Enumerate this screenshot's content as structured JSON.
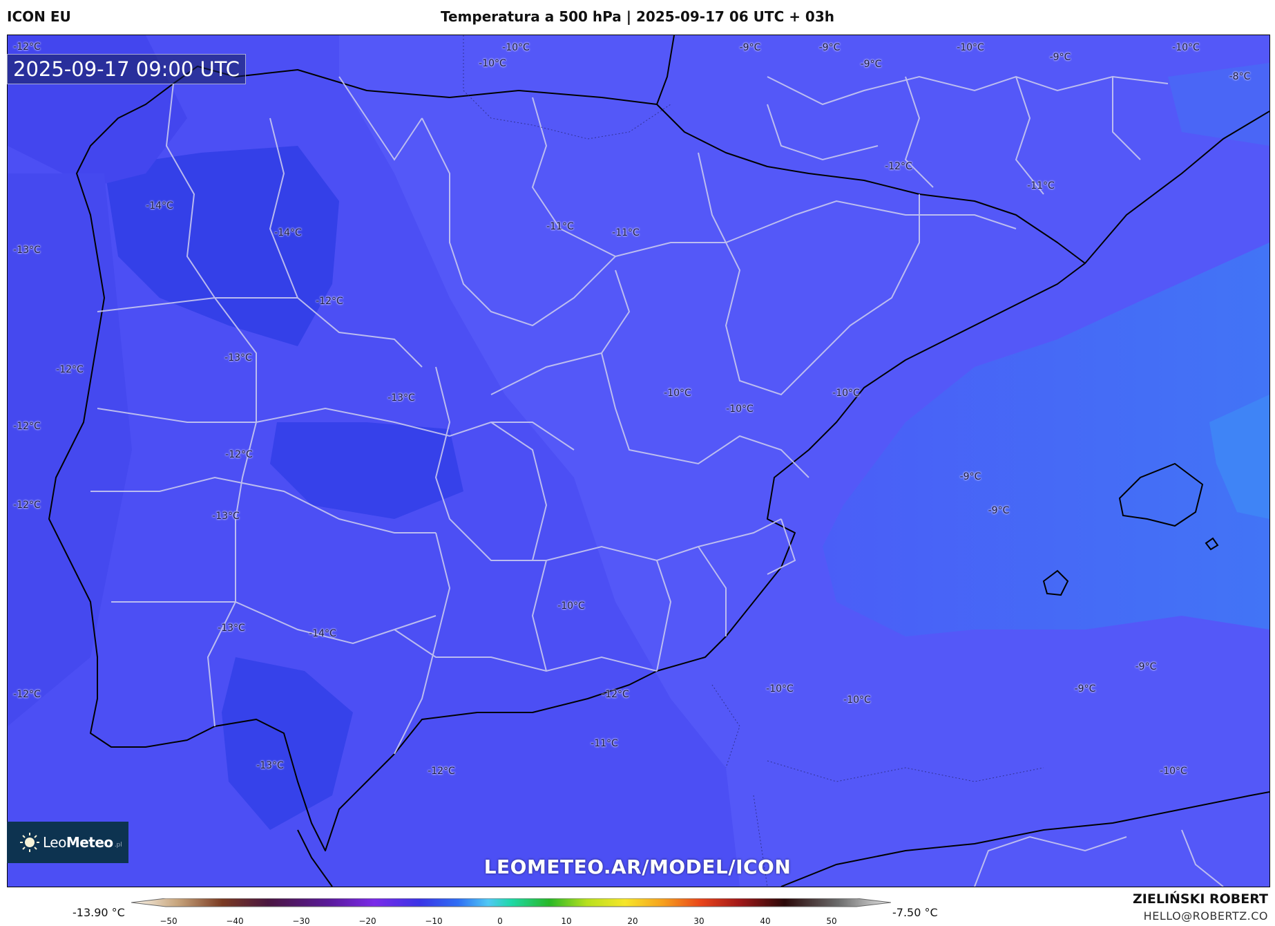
{
  "header": {
    "model": "ICON EU",
    "title": "Temperatura a 500 hPa | 2025-09-17 06 UTC + 03h"
  },
  "map": {
    "timestamp": "2025-09-17 09:00 UTC",
    "watermark": "LEOMETEO.AR/MODEL/ICON",
    "field_colors": {
      "very_cold": "#2f3fe8",
      "cold": "#3c46f0",
      "mid": "#5356f8",
      "sea_warm": "#4b63f6",
      "warmest": "#3f80f5",
      "boundary_line": "#c8c8f0",
      "coast_line": "#000000"
    },
    "labels": [
      {
        "text": "-12°C",
        "key": "l1"
      },
      {
        "text": "-10°C",
        "key": "l2"
      },
      {
        "text": "-10°C",
        "key": "l3"
      },
      {
        "text": "-9°C",
        "key": "l4"
      },
      {
        "text": "-9°C",
        "key": "l5"
      },
      {
        "text": "-9°C",
        "key": "l6"
      },
      {
        "text": "-10°C",
        "key": "l7"
      },
      {
        "text": "-9°C",
        "key": "l8"
      },
      {
        "text": "-10°C",
        "key": "l9"
      },
      {
        "text": "-8°C",
        "key": "l10"
      },
      {
        "text": "-12°C",
        "key": "l11"
      },
      {
        "text": "-11°C",
        "key": "l12"
      },
      {
        "text": "-14°C",
        "key": "l13"
      },
      {
        "text": "-14°C",
        "key": "l14"
      },
      {
        "text": "-11°C",
        "key": "l15"
      },
      {
        "text": "-11°C",
        "key": "l16"
      },
      {
        "text": "-13°C",
        "key": "l17"
      },
      {
        "text": "-12°C",
        "key": "l18"
      },
      {
        "text": "-13°C",
        "key": "l19"
      },
      {
        "text": "-12°C",
        "key": "l20"
      },
      {
        "text": "-13°C",
        "key": "l21"
      },
      {
        "text": "-10°C",
        "key": "l22"
      },
      {
        "text": "-10°C",
        "key": "l23"
      },
      {
        "text": "-10°C",
        "key": "l24"
      },
      {
        "text": "-12°C",
        "key": "l25"
      },
      {
        "text": "-12°C",
        "key": "l26"
      },
      {
        "text": "-9°C",
        "key": "l27"
      },
      {
        "text": "-12°C",
        "key": "l28"
      },
      {
        "text": "-13°C",
        "key": "l29"
      },
      {
        "text": "-9°C",
        "key": "l30"
      },
      {
        "text": "-10°C",
        "key": "l31"
      },
      {
        "text": "-13°C",
        "key": "l32"
      },
      {
        "text": "-14°C",
        "key": "l33"
      },
      {
        "text": "-9°C",
        "key": "l34"
      },
      {
        "text": "-12°C",
        "key": "l35"
      },
      {
        "text": "-10°C",
        "key": "l36"
      },
      {
        "text": "-12°C",
        "key": "l37"
      },
      {
        "text": "-10°C",
        "key": "l38"
      },
      {
        "text": "-9°C",
        "key": "l39"
      },
      {
        "text": "-11°C",
        "key": "l40"
      },
      {
        "text": "-13°C",
        "key": "l41"
      },
      {
        "text": "-12°C",
        "key": "l42"
      },
      {
        "text": "-10°C",
        "key": "l43"
      }
    ]
  },
  "logo": {
    "text_light": "Leo",
    "text_bold": "Meteo",
    "suffix": ".pl"
  },
  "colorbar": {
    "min_label": "-13.90 °C",
    "max_label": "-7.50 °C",
    "ticks": [
      "−50",
      "−40",
      "−30",
      "−20",
      "−10",
      "0",
      "10",
      "20",
      "30",
      "40",
      "50"
    ]
  },
  "author": {
    "name": "ZIELIŃSKI ROBERT",
    "email": "HELLO@ROBERTZ.CO"
  }
}
